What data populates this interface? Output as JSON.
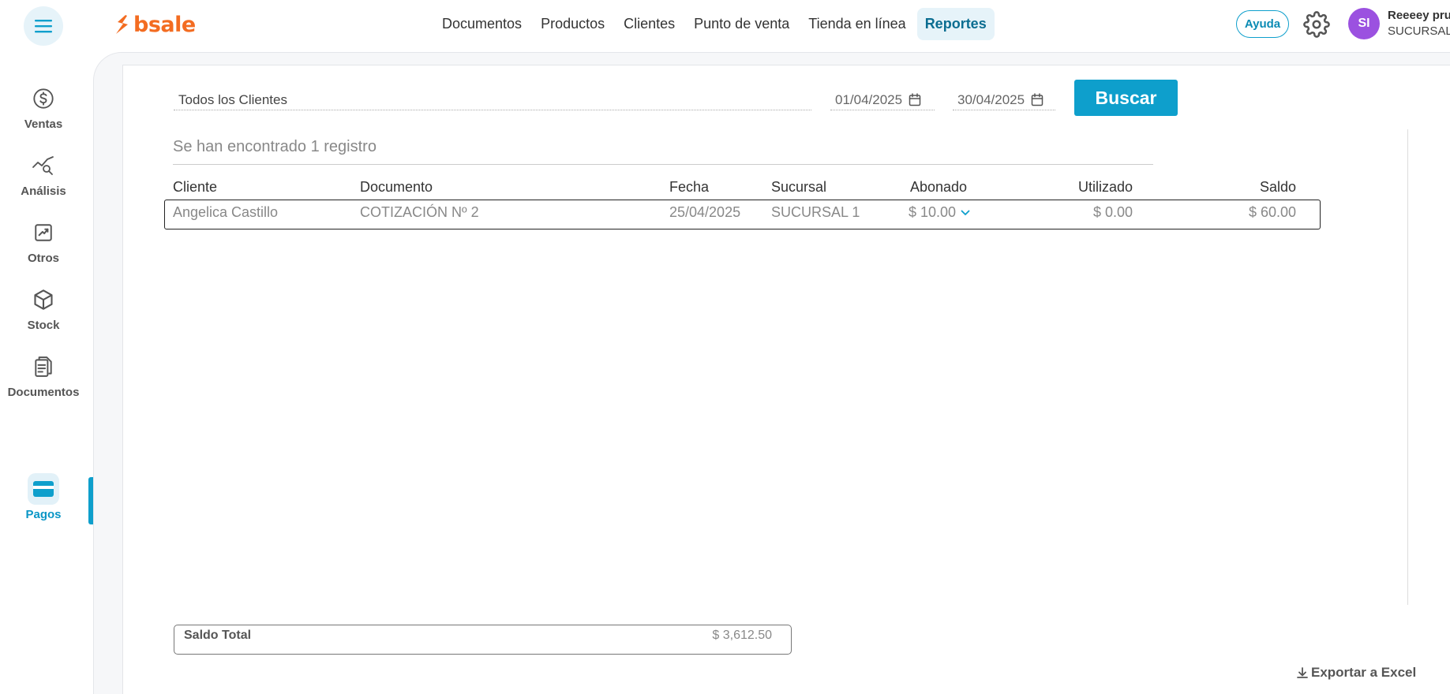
{
  "header": {
    "logo_text": "bsale",
    "nav": [
      {
        "label": "Documentos"
      },
      {
        "label": "Productos"
      },
      {
        "label": "Clientes"
      },
      {
        "label": "Punto de venta"
      },
      {
        "label": "Tienda en línea"
      },
      {
        "label": "Reportes",
        "active": true
      }
    ],
    "help_label": "Ayuda",
    "avatar_initials": "SI",
    "user_name": "Reeeey pru",
    "user_branch": "SUCURSAL"
  },
  "sidebar": {
    "items": [
      {
        "label": "Ventas",
        "icon": "dollar-circle-icon"
      },
      {
        "label": "Análisis",
        "icon": "analytics-icon"
      },
      {
        "label": "Otros",
        "icon": "trend-chart-icon"
      },
      {
        "label": "Stock",
        "icon": "box-icon"
      },
      {
        "label": "Documentos",
        "icon": "document-icon"
      },
      {
        "label": "Pagos",
        "icon": "card-icon",
        "active": true
      }
    ]
  },
  "filters": {
    "client": "Todos los Clientes",
    "date_from": "01/04/2025",
    "date_to": "30/04/2025",
    "search_label": "Buscar"
  },
  "results": {
    "summary": "Se han encontrado 1 registro",
    "columns": [
      "Cliente",
      "Documento",
      "Fecha",
      "Sucursal",
      "Abonado",
      "Utilizado",
      "Saldo"
    ],
    "rows": [
      {
        "cliente": "Angelica Castillo",
        "documento": "COTIZACIÓN Nº 2",
        "fecha": "25/04/2025",
        "sucursal": "SUCURSAL 1",
        "abonado": "$ 10.00",
        "utilizado": "$ 0.00",
        "saldo": "$ 60.00"
      }
    ]
  },
  "totals": {
    "label": "Saldo Total",
    "value": "$ 3,612.50"
  },
  "export_label": "Exportar a Excel",
  "colors": {
    "accent": "#0e9fcc",
    "brand": "#f36c21",
    "avatar": "#9b51e0"
  }
}
